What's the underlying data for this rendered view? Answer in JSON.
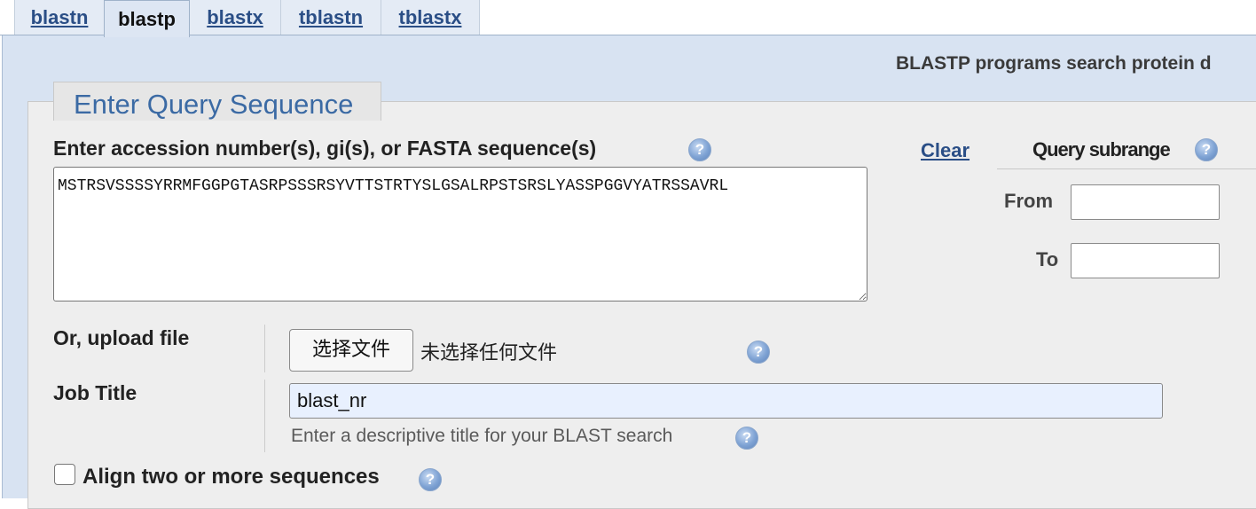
{
  "tabs": [
    {
      "label": "blastn",
      "active": false
    },
    {
      "label": "blastp",
      "active": true
    },
    {
      "label": "blastx",
      "active": false
    },
    {
      "label": "tblastn",
      "active": false
    },
    {
      "label": "tblastx",
      "active": false
    }
  ],
  "description": "BLASTP programs search protein d",
  "section_title": "Enter Query Sequence",
  "query": {
    "label": "Enter accession number(s), gi(s), or FASTA sequence(s)",
    "sequence": "MSTRSVSSSSYRRMFGGPGTASRPSSSRSYVTTSTRTYSLGSALRPSTSRSLYASSPGGVYATRSSAVRL",
    "clear_label": "Clear"
  },
  "subrange": {
    "title": "Query subrange",
    "from_label": "From",
    "to_label": "To",
    "from_value": "",
    "to_value": ""
  },
  "upload": {
    "label": "Or, upload file",
    "button_label": "选择文件",
    "status": "未选择任何文件"
  },
  "job": {
    "label": "Job Title",
    "value": "blast_nr",
    "hint": "Enter a descriptive title for your BLAST search"
  },
  "align": {
    "label": "Align two or more sequences",
    "checked": false
  },
  "help_icon_glyph": "?",
  "icons": {
    "help": "question-circle-icon",
    "resize": "resize-grip-icon"
  },
  "colors": {
    "tab_link": "#2a4e86",
    "band_bg": "#d8e3f2",
    "panel_bg": "#eeeeee",
    "section_title": "#3b6aa4",
    "autofill_input": "#e8f0fe"
  }
}
